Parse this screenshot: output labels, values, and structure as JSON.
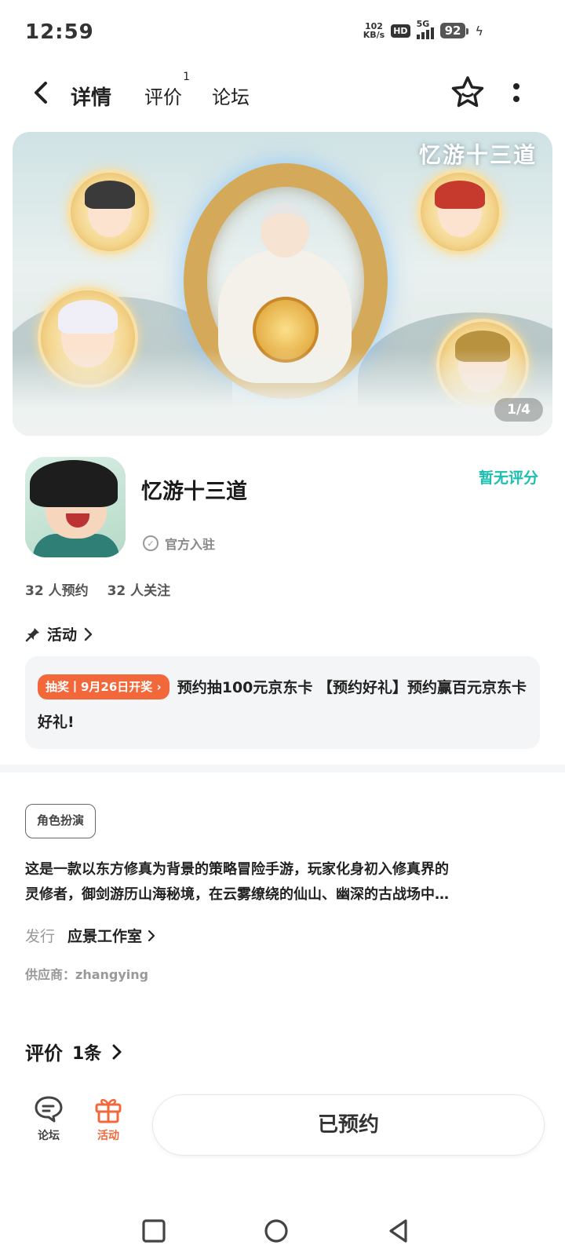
{
  "status_bar": {
    "time": "12:59",
    "net_speed_value": "102",
    "net_speed_unit": "KB/s",
    "hd": "HD",
    "network": "5G",
    "battery": "92"
  },
  "nav": {
    "tabs": [
      {
        "label": "详情",
        "active": true
      },
      {
        "label": "评价",
        "superscript": "1"
      },
      {
        "label": "论坛"
      }
    ]
  },
  "banner": {
    "watermark_title": "忆游十三道",
    "page_indicator": "1/4"
  },
  "app": {
    "name": "忆游十三道",
    "rating_status": "暂无评分",
    "official_label": "官方入驻",
    "reservations": "32 人预约",
    "followers": "32 人关注"
  },
  "activity": {
    "header": "活动",
    "badge": "抽奖丨9月26日开奖",
    "text": "预约抽100元京东卡 【预约好礼】预约赢百元京东卡好礼!"
  },
  "details": {
    "tag": "角色扮演",
    "description_line1": "这是一款以东方修真为背景的策略冒险手游，玩家化身初入修真界的",
    "description_line2": "灵修者，御剑游历山海秘境，在云雾缭绕的仙山、幽深的古战场中…",
    "publisher_label": "发行",
    "publisher_value": "应景工作室",
    "supplier": "供应商：zhangying"
  },
  "reviews": {
    "title": "评价",
    "count": "1条"
  },
  "bottom_bar": {
    "forum_label": "论坛",
    "activity_label": "活动",
    "reserve_button": "已预约"
  },
  "colors": {
    "accent_teal": "#19c0b0",
    "accent_orange": "#f2683a"
  }
}
